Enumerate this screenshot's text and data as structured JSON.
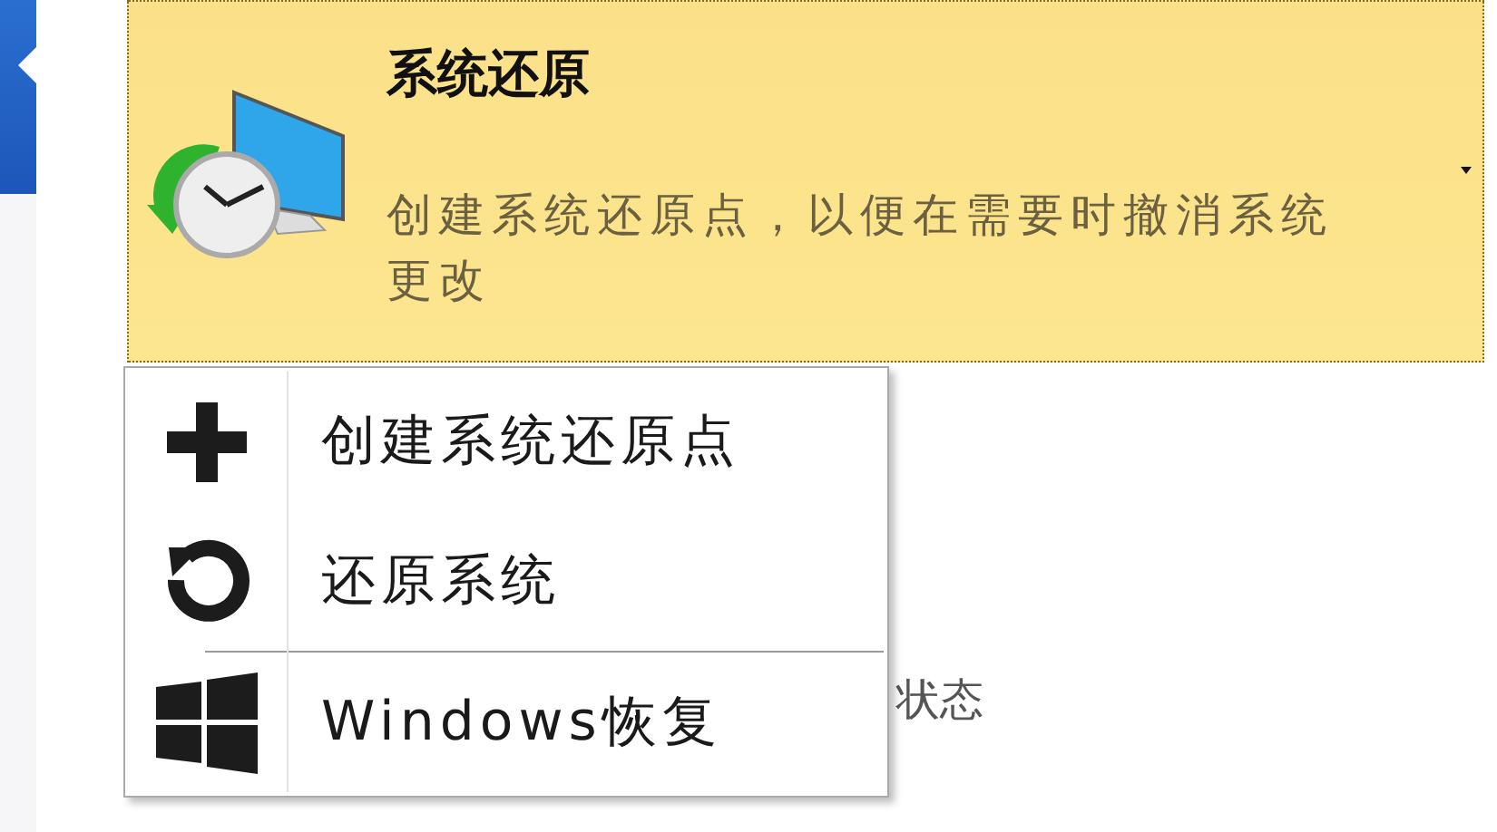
{
  "tile": {
    "title": "系统还原",
    "description": "创建系统还原点，以便在需要时撤消系统更改"
  },
  "background_text": "状态",
  "menu": {
    "sections": [
      {
        "items": [
          {
            "label": "创建系统还原点",
            "kind": "plus"
          },
          {
            "label": "还原系统",
            "kind": "undo"
          }
        ]
      },
      {
        "items": [
          {
            "label": "Windows恢复",
            "kind": "windows"
          }
        ]
      }
    ]
  }
}
